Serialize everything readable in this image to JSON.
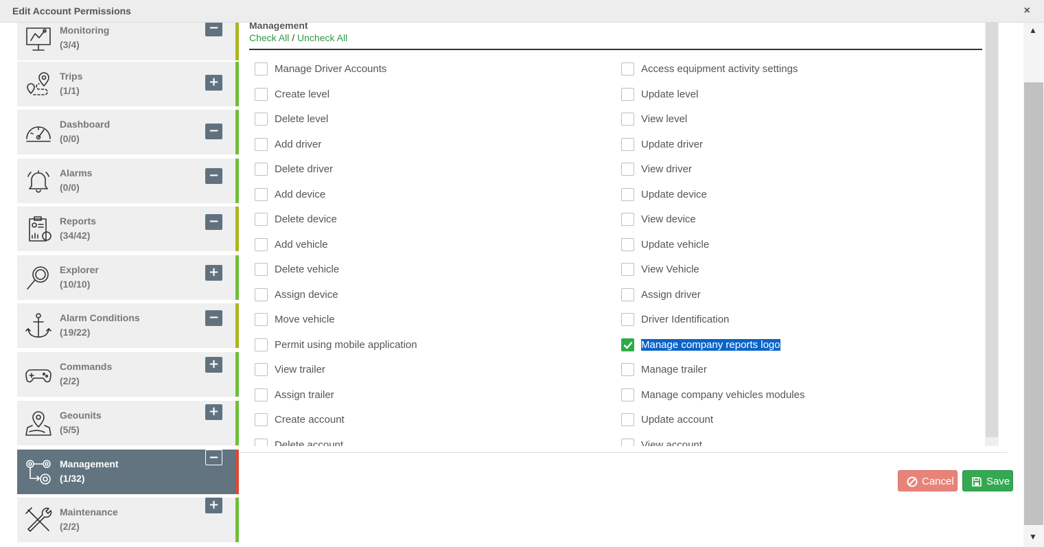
{
  "window": {
    "title": "Edit Account Permissions",
    "close_symbol": "×"
  },
  "sidebar": {
    "categories": [
      {
        "name": "Monitoring",
        "count": "(3/4)",
        "toggle": "−",
        "status": "partial",
        "icon": "monitoring-icon"
      },
      {
        "name": "Trips",
        "count": "(1/1)",
        "toggle": "+",
        "status": "full",
        "icon": "trips-route-icon"
      },
      {
        "name": "Dashboard",
        "count": "(0/0)",
        "toggle": "−",
        "status": "full",
        "icon": "dashboard-gauge-icon"
      },
      {
        "name": "Alarms",
        "count": "(0/0)",
        "toggle": "−",
        "status": "full",
        "icon": "alarm-bell-icon"
      },
      {
        "name": "Reports",
        "count": "(34/42)",
        "toggle": "−",
        "status": "partial",
        "icon": "reports-clipboard-icon"
      },
      {
        "name": "Explorer",
        "count": "(10/10)",
        "toggle": "+",
        "status": "full",
        "icon": "magnifier-icon"
      },
      {
        "name": "Alarm Conditions",
        "count": "(19/22)",
        "toggle": "−",
        "status": "partial",
        "icon": "anchor-icon"
      },
      {
        "name": "Commands",
        "count": "(2/2)",
        "toggle": "+",
        "status": "full",
        "icon": "gamepad-icon"
      },
      {
        "name": "Geounits",
        "count": "(5/5)",
        "toggle": "+",
        "status": "full",
        "icon": "map-pin-icon"
      },
      {
        "name": "Management",
        "count": "(1/32)",
        "toggle": "−",
        "status": "active",
        "icon": "management-gears-icon"
      },
      {
        "name": "Maintenance",
        "count": "(2/2)",
        "toggle": "+",
        "status": "full",
        "icon": "wrench-screwdriver-icon"
      }
    ]
  },
  "section": {
    "title": "Management",
    "check_all": "Check All",
    "separator": "/",
    "uncheck_all": "Uncheck All"
  },
  "permissions": {
    "left": [
      {
        "label": "Manage Driver Accounts",
        "checked": false
      },
      {
        "label": "Create level",
        "checked": false
      },
      {
        "label": "Delete level",
        "checked": false
      },
      {
        "label": "Add driver",
        "checked": false
      },
      {
        "label": "Delete driver",
        "checked": false
      },
      {
        "label": "Add device",
        "checked": false
      },
      {
        "label": "Delete device",
        "checked": false
      },
      {
        "label": "Add vehicle",
        "checked": false
      },
      {
        "label": "Delete vehicle",
        "checked": false
      },
      {
        "label": "Assign device",
        "checked": false
      },
      {
        "label": "Move vehicle",
        "checked": false
      },
      {
        "label": "Permit using mobile application",
        "checked": false
      },
      {
        "label": "View trailer",
        "checked": false
      },
      {
        "label": "Assign trailer",
        "checked": false
      },
      {
        "label": "Create account",
        "checked": false
      },
      {
        "label": "Delete account",
        "checked": false
      }
    ],
    "right": [
      {
        "label": "Access equipment activity settings",
        "checked": false
      },
      {
        "label": "Update level",
        "checked": false
      },
      {
        "label": "View level",
        "checked": false
      },
      {
        "label": "Update driver",
        "checked": false
      },
      {
        "label": "View driver",
        "checked": false
      },
      {
        "label": "Update device",
        "checked": false
      },
      {
        "label": "View device",
        "checked": false
      },
      {
        "label": "Update vehicle",
        "checked": false
      },
      {
        "label": "View Vehicle",
        "checked": false
      },
      {
        "label": "Assign driver",
        "checked": false
      },
      {
        "label": "Driver Identification",
        "checked": false
      },
      {
        "label": "Manage company reports logo",
        "checked": true,
        "selected": true
      },
      {
        "label": "Manage trailer",
        "checked": false
      },
      {
        "label": "Manage company vehicles modules",
        "checked": false
      },
      {
        "label": "Update account",
        "checked": false
      },
      {
        "label": "View account",
        "checked": false
      }
    ]
  },
  "footer": {
    "cancel_label": "Cancel",
    "save_label": "Save"
  },
  "colors": {
    "accent_green": "#35a852",
    "active_category": "#617480",
    "cancel": "#e8837a",
    "status_full": "#6fbf3a",
    "status_partial": "#a9b71f",
    "status_active": "#d84a38"
  }
}
